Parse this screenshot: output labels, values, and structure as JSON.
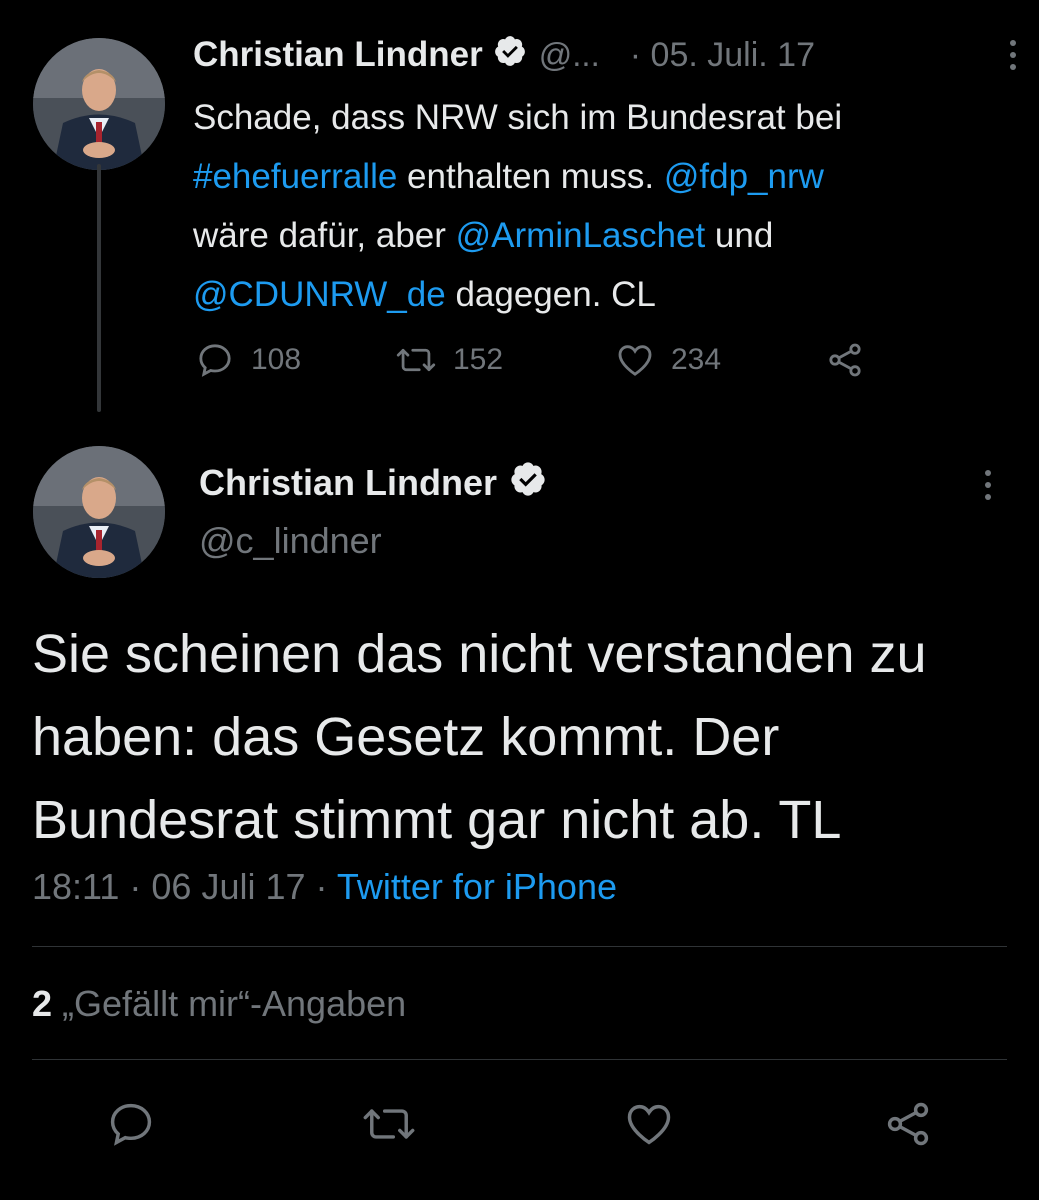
{
  "tweet1": {
    "author_name": "Christian Lindner",
    "handle_truncated": "@...",
    "date": "· 05. Juli. 17",
    "text_parts": {
      "line1": "Schade, dass NRW sich im Bundesrat bei",
      "hashtag": "#ehefuerralle",
      "mid1": " enthalten muss. ",
      "mention1": "@fdp_nrw",
      "line3_start": "wäre dafür, aber ",
      "mention2": "@ArminLaschet",
      "line3_end": " und",
      "mention3": "@CDUNRW_de",
      "line4_end": " dagegen. CL"
    },
    "replies": "108",
    "retweets": "152",
    "likes": "234"
  },
  "tweet2": {
    "author_name": "Christian Lindner",
    "handle": "@c_lindner",
    "text": "Sie scheinen das nicht verstanden zu haben: das Gesetz kommt. Der Bundesrat stimmt gar nicht ab. TL",
    "time_date": "18:11 · 06 Juli 17 · ",
    "source": "Twitter for iPhone",
    "likes_count": "2",
    "likes_label": " „Gefällt mir“-Angaben"
  },
  "icons": {
    "verified": "verified-badge-icon",
    "more": "more-dots-icon",
    "reply": "reply-icon",
    "retweet": "retweet-icon",
    "like": "heart-icon",
    "share": "share-icon"
  },
  "colors": {
    "background": "#000000",
    "text": "#e7e9ea",
    "muted": "#71767b",
    "link": "#1d9bf0",
    "divider": "#2f3336"
  }
}
